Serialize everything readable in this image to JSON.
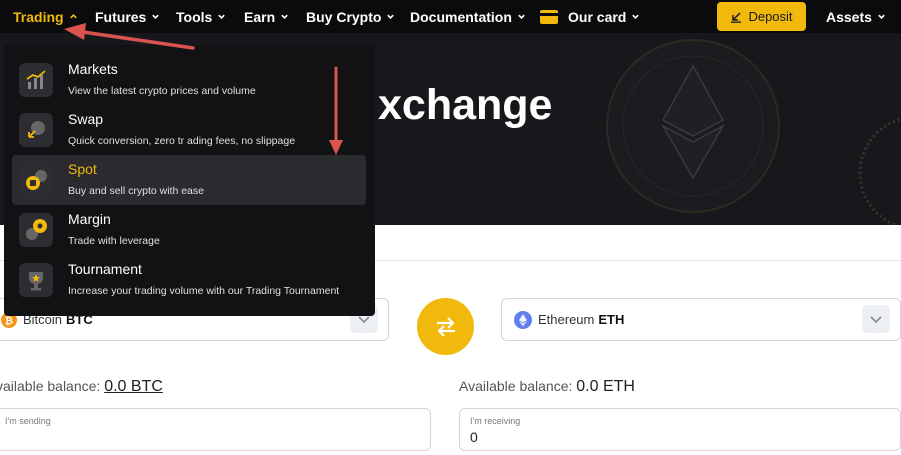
{
  "nav": {
    "items": [
      {
        "label": "Trading",
        "active": true
      },
      {
        "label": "Futures"
      },
      {
        "label": "Tools"
      },
      {
        "label": "Earn"
      },
      {
        "label": "Buy Crypto"
      },
      {
        "label": "Documentation"
      },
      {
        "label": "Our card",
        "icon": "card-icon"
      }
    ],
    "deposit_label": "Deposit",
    "assets_label": "Assets"
  },
  "hero": {
    "title_visible": "xchange"
  },
  "trading_menu": {
    "items": [
      {
        "title": "Markets",
        "desc": "View the latest crypto prices and volume",
        "icon": "markets-icon"
      },
      {
        "title": "Swap",
        "desc": "Quick conversion, zero tr ading fees, no slippage",
        "icon": "swap-icon"
      },
      {
        "title": "Spot",
        "desc": "Buy and sell crypto with ease",
        "icon": "spot-icon",
        "highlighted": true
      },
      {
        "title": "Margin",
        "desc": "Trade with leverage",
        "icon": "margin-icon"
      },
      {
        "title": "Tournament",
        "desc": "Increase your trading volume with our Trading Tournament",
        "icon": "trophy-icon"
      }
    ]
  },
  "swap": {
    "from": {
      "name": "Bitcoin",
      "ticker": "BTC",
      "balance_label": "vailable balance:",
      "balance_value": "0.0 BTC",
      "amount_label": "I'm sending",
      "amount_value": ""
    },
    "to": {
      "name": "Ethereum",
      "ticker": "ETH",
      "balance_label": "Available balance:",
      "balance_value": "0.0 ETH",
      "amount_label": "I'm receiving",
      "amount_value": "0"
    }
  },
  "colors": {
    "accent": "#f0b90b",
    "nav_bg": "#0b0b0d",
    "menu_bg": "#121215",
    "menu_highlight": "#2a2a2f",
    "annotation_arrow": "#d9534f"
  }
}
